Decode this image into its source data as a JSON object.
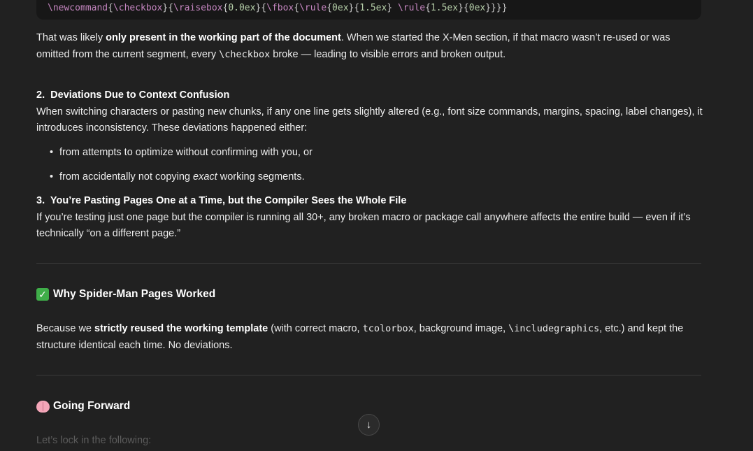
{
  "code": {
    "tokens": [
      {
        "t": "\\newcommand",
        "k": "cmd"
      },
      {
        "t": "{",
        "k": "br"
      },
      {
        "t": "\\checkbox",
        "k": "cmd"
      },
      {
        "t": "}{",
        "k": "br"
      },
      {
        "t": "\\raisebox",
        "k": "cmd"
      },
      {
        "t": "{",
        "k": "br"
      },
      {
        "t": "0.0ex",
        "k": "arg"
      },
      {
        "t": "}{",
        "k": "br"
      },
      {
        "t": "\\fbox",
        "k": "cmd"
      },
      {
        "t": "{",
        "k": "br"
      },
      {
        "t": "\\rule",
        "k": "cmd"
      },
      {
        "t": "{",
        "k": "br"
      },
      {
        "t": "0ex",
        "k": "arg"
      },
      {
        "t": "}{",
        "k": "br"
      },
      {
        "t": "1.5ex",
        "k": "arg"
      },
      {
        "t": "} ",
        "k": "br"
      },
      {
        "t": "\\rule",
        "k": "cmd"
      },
      {
        "t": "{",
        "k": "br"
      },
      {
        "t": "1.5ex",
        "k": "arg"
      },
      {
        "t": "}{",
        "k": "br"
      },
      {
        "t": "0ex",
        "k": "arg"
      },
      {
        "t": "}}}}",
        "k": "br"
      }
    ]
  },
  "para1": {
    "a": "That was likely ",
    "b": "only present in the working part of the document",
    "c": ". When we started the X-Men section, if that macro wasn’t re-used or was omitted from the current segment, every ",
    "code": "\\checkbox",
    "d": " broke — leading to visible errors and broken output."
  },
  "item2": {
    "number": "2.",
    "title": "Deviations Due to Context Confusion",
    "body": "When switching characters or pasting new chunks, if any one line gets slightly altered (e.g., font size commands, margins, spacing, label changes), it introduces inconsistency. These deviations happened either:",
    "bullets": [
      {
        "pre": "from attempts to optimize without confirming with you, or",
        "em": "",
        "post": ""
      },
      {
        "pre": "from accidentally not copying ",
        "em": "exact",
        "post": " working segments."
      }
    ]
  },
  "item3": {
    "number": "3.",
    "title": "You’re Pasting Pages One at a Time, but the Compiler Sees the Whole File",
    "body": "If you’re testing just one page but the compiler is running all 30+, any broken macro or package call anywhere affects the entire build — even if it’s technically “on a different page.”"
  },
  "section_spiderman": {
    "icon": "check-mark-emoji",
    "title": "Why Spider-Man Pages Worked",
    "a": "Because we ",
    "b": "strictly reused the working template",
    "c": " (with correct macro, ",
    "code1": "tcolorbox",
    "d": ", background image, ",
    "code2": "\\includegraphics",
    "e": ", etc.) and kept the structure identical each time. No deviations."
  },
  "section_forward": {
    "icon": "brain-emoji",
    "title": "Going Forward",
    "intro": "Let’s lock in the following:"
  },
  "scroll_button": {
    "icon": "arrow-down-icon",
    "glyph": "↓"
  },
  "colors": {
    "background": "#212121",
    "code_background": "#171717",
    "text": "#ececec",
    "code_command": "#c586c0",
    "code_argument": "#b5cea8",
    "check_emoji": "#3fae49"
  }
}
